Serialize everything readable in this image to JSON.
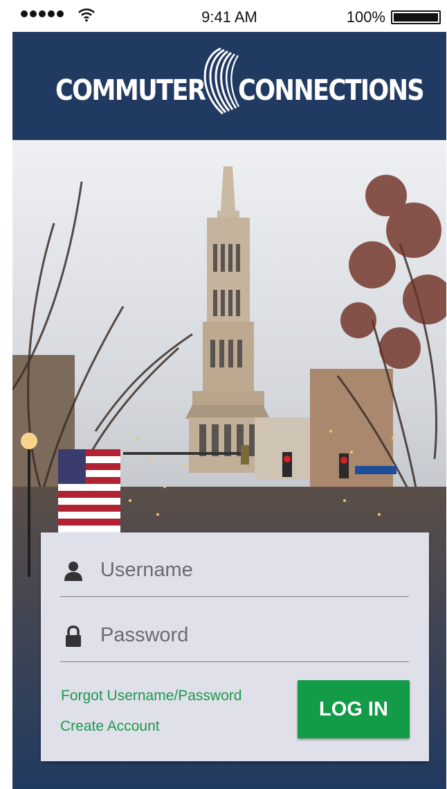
{
  "status_bar": {
    "time": "9:41 AM",
    "battery_percent": "100%",
    "signal_bars": 5,
    "icons": [
      "signal-dots-icon",
      "wifi-icon",
      "battery-icon"
    ]
  },
  "header": {
    "logo_left": "COMMUTER",
    "logo_right": "CONNECTIONS",
    "logo_registered": "®",
    "background_color": "#213a61"
  },
  "login": {
    "username_placeholder": "Username",
    "password_placeholder": "Password",
    "forgot_label": "Forgot Username/Password",
    "create_account_label": "Create Account",
    "login_button_label": "LOG IN",
    "icons": [
      "user-icon",
      "lock-icon"
    ],
    "accent_color": "#139b47"
  }
}
